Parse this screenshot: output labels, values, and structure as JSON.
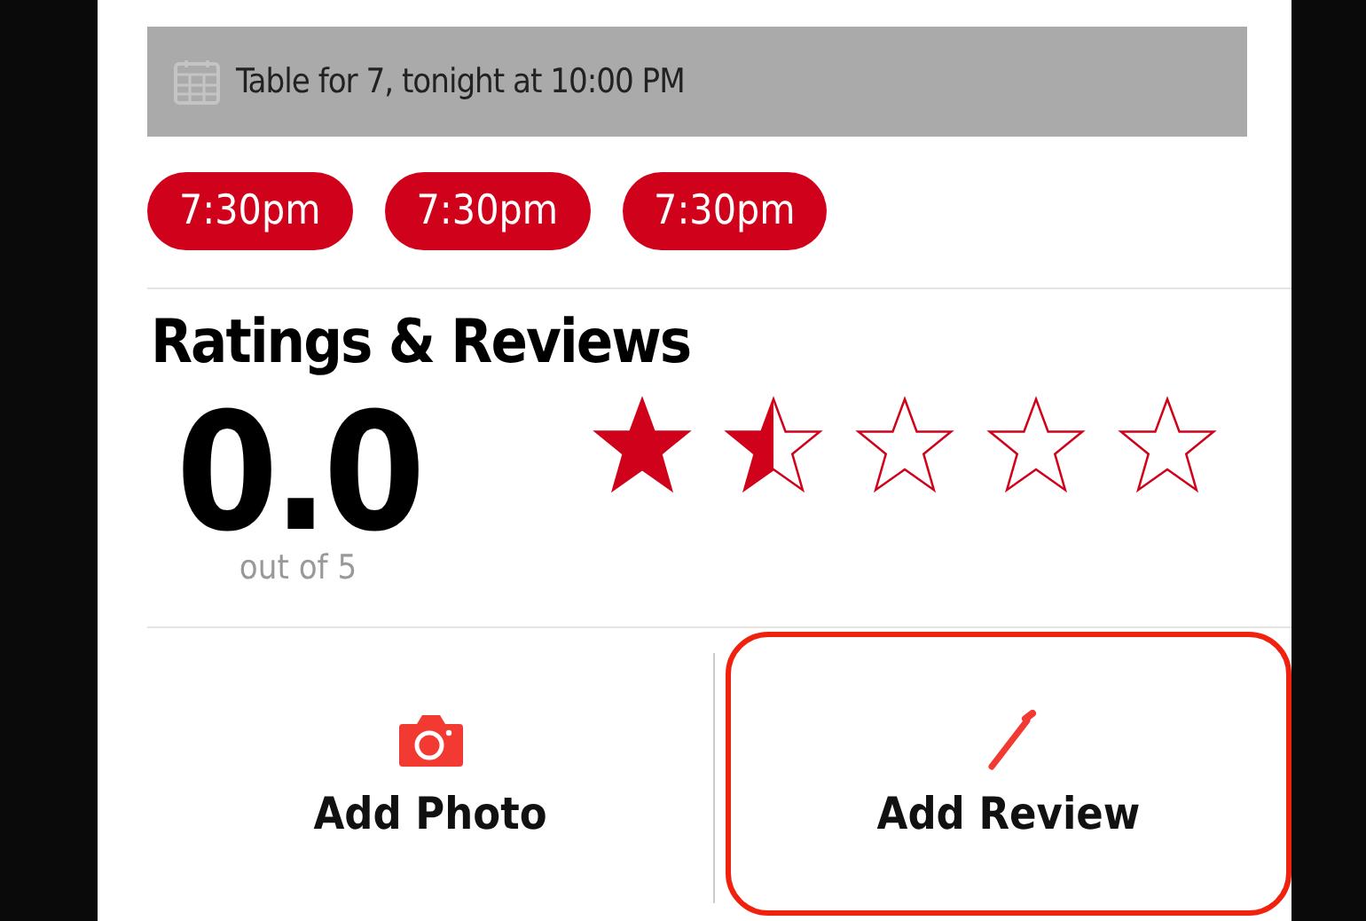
{
  "reservation": {
    "text": "Table for 7, tonight at 10:00 PM"
  },
  "time_slots": [
    {
      "label": "7:30pm"
    },
    {
      "label": "7:30pm"
    },
    {
      "label": "7:30pm"
    }
  ],
  "ratings": {
    "title": "Ratings & Reviews",
    "score": "0.0",
    "scale": "out of 5",
    "stars": 1.5
  },
  "actions": [
    {
      "kind": "photo",
      "label": "Add Photo",
      "selected": false
    },
    {
      "kind": "review",
      "label": "Add Review",
      "selected": true
    }
  ]
}
